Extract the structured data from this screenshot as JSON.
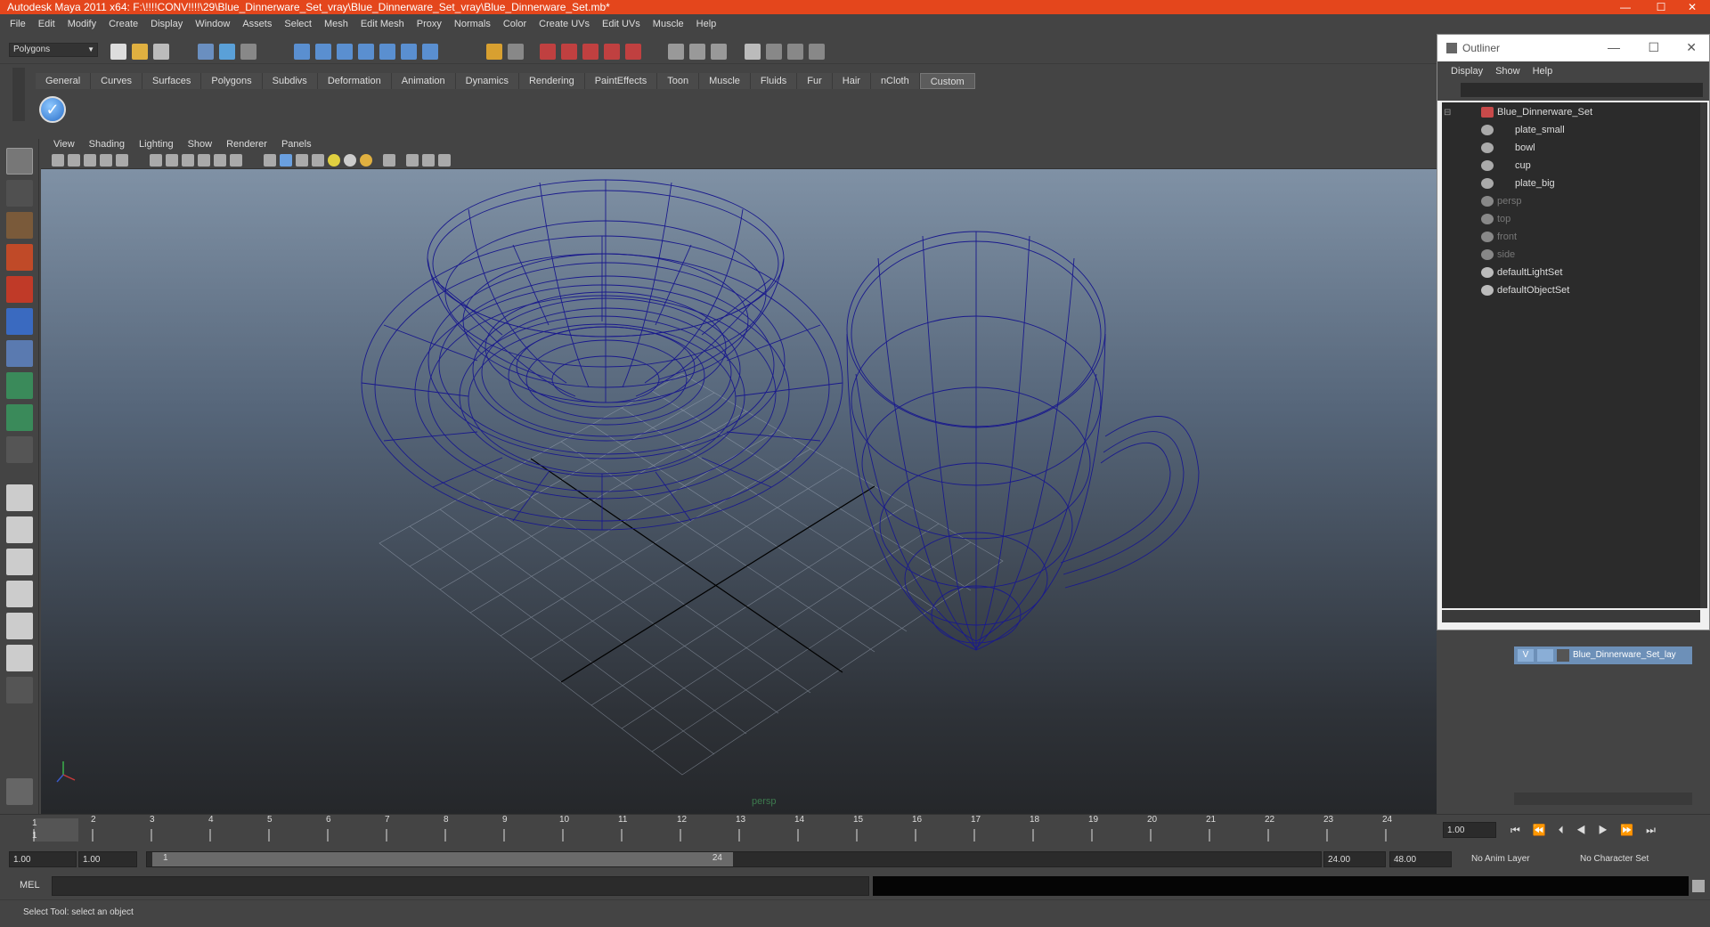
{
  "window": {
    "title": "Autodesk Maya 2011 x64: F:\\!!!!CONV!!!!\\29\\Blue_Dinnerware_Set_vray\\Blue_Dinnerware_Set_vray\\Blue_Dinnerware_Set.mb*",
    "min": "—",
    "max": "☐",
    "close": "✕"
  },
  "menubar": [
    "File",
    "Edit",
    "Modify",
    "Create",
    "Display",
    "Window",
    "Assets",
    "Select",
    "Mesh",
    "Edit Mesh",
    "Proxy",
    "Normals",
    "Color",
    "Create UVs",
    "Edit UVs",
    "Muscle",
    "Help"
  ],
  "mode_select": "Polygons",
  "shelf_tabs": [
    "General",
    "Curves",
    "Surfaces",
    "Polygons",
    "Subdivs",
    "Deformation",
    "Animation",
    "Dynamics",
    "Rendering",
    "PaintEffects",
    "Toon",
    "Muscle",
    "Fluids",
    "Fur",
    "Hair",
    "nCloth",
    "Custom"
  ],
  "shelf_active_tab": "Custom",
  "viewport": {
    "menu": [
      "View",
      "Shading",
      "Lighting",
      "Show",
      "Renderer",
      "Panels"
    ],
    "camera_label": "persp",
    "wire_color": "#1a1a8c"
  },
  "timeline": {
    "ticks": [
      "1",
      "2",
      "3",
      "4",
      "5",
      "6",
      "7",
      "8",
      "9",
      "10",
      "11",
      "12",
      "13",
      "14",
      "15",
      "16",
      "17",
      "18",
      "19",
      "20",
      "21",
      "22",
      "23",
      "24"
    ],
    "current_frame": "1.00",
    "current_marker": "1"
  },
  "range": {
    "start": "1.00",
    "start2": "1.00",
    "range_start_label": "1",
    "range_end_label": "24",
    "end": "24.00",
    "end2": "48.00",
    "anim_layer": "No Anim Layer",
    "char_set": "No Character Set"
  },
  "cmdline": {
    "label": "MEL"
  },
  "helpline": {
    "text": "Select Tool: select an object"
  },
  "outliner": {
    "title": "Outliner",
    "menu": [
      "Display",
      "Show",
      "Help"
    ],
    "items": [
      {
        "label": "Blue_Dinnerware_Set",
        "dim": false,
        "indent": 0
      },
      {
        "label": "plate_small",
        "dim": false,
        "indent": 1
      },
      {
        "label": "bowl",
        "dim": false,
        "indent": 1
      },
      {
        "label": "cup",
        "dim": false,
        "indent": 1
      },
      {
        "label": "plate_big",
        "dim": false,
        "indent": 1
      },
      {
        "label": "persp",
        "dim": true,
        "indent": 0
      },
      {
        "label": "top",
        "dim": true,
        "indent": 0
      },
      {
        "label": "front",
        "dim": true,
        "indent": 0
      },
      {
        "label": "side",
        "dim": true,
        "indent": 0
      },
      {
        "label": "defaultLightSet",
        "dim": false,
        "indent": 0
      },
      {
        "label": "defaultObjectSet",
        "dim": false,
        "indent": 0
      }
    ]
  },
  "layers": {
    "visibility": "V",
    "name": "Blue_Dinnerware_Set_lay"
  }
}
